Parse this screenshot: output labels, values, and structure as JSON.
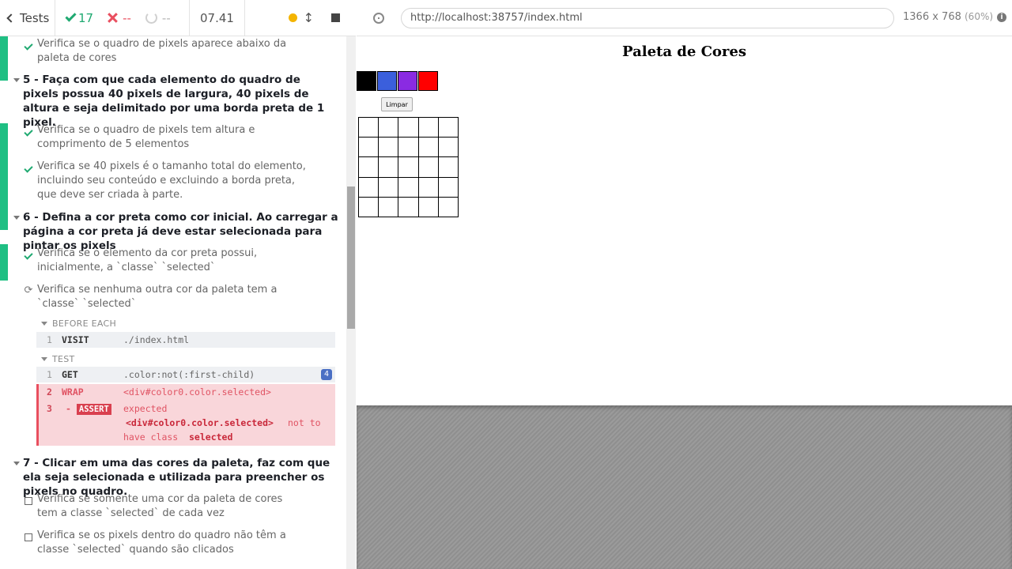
{
  "topbar": {
    "tests_label": "Tests",
    "passed": "17",
    "failed": "--",
    "pending": "--",
    "duration": "07.41"
  },
  "runner": {
    "url": "http://localhost:38757/index.html",
    "viewport": "1366 x 768",
    "scale": "(60%)"
  },
  "suites": {
    "prev_test": "Verifica se o quadro de pixels aparece abaixo da paleta de cores",
    "s5": {
      "title": "5 - Faça com que cada elemento do quadro de pixels possua 40 pixels de largura, 40 pixels de altura e seja delimitado por uma borda preta de 1 pixel.",
      "t1": "Verifica se o quadro de pixels tem altura e comprimento de 5 elementos",
      "t2": "Verifica se 40 pixels é o tamanho total do elemento, incluindo seu conteúdo e excluindo a borda preta, que deve ser criada à parte."
    },
    "s6": {
      "title": "6 - Defina a cor preta como cor inicial. Ao carregar a página a cor preta já deve estar selecionada para pintar os pixels",
      "t1": "Verifica se o elemento da cor preta possui, inicialmente, a `classe` `selected`",
      "t2": "Verifica se nenhuma outra cor da paleta tem a `classe` `selected`",
      "before_each": "BEFORE EACH",
      "visit_num": "1",
      "visit_name": "VISIT",
      "visit_msg": "./index.html",
      "test_label": "TEST",
      "get_num": "1",
      "get_name": "GET",
      "get_msg": ".color:not(:first-child)",
      "get_badge": "4",
      "wrap_num": "2",
      "wrap_name": "WRAP",
      "wrap_msg": "<div#color0.color.selected>",
      "assert_num": "3",
      "assert_prefix": "-",
      "assert_name": "ASSERT",
      "assert_expected": "expected",
      "assert_el": "<div#color0.color.selected>",
      "assert_not": "not to",
      "assert_have": "have class",
      "assert_cls": "selected"
    },
    "s7": {
      "title": "7 - Clicar em uma das cores da paleta, faz com que ela seja selecionada e utilizada para preencher os pixels no quadro.",
      "t1": "Verifica se somente uma cor da paleta de cores tem a classe `selected` de cada vez",
      "t2": "Verifica se os pixels dentro do quadro não têm a classe `selected` quando são clicados"
    }
  },
  "app": {
    "title": "Paleta de Cores",
    "clear_label": "Limpar",
    "colors": [
      "#000000",
      "#3b5fdc",
      "#8a2be2",
      "#ff0000"
    ]
  }
}
